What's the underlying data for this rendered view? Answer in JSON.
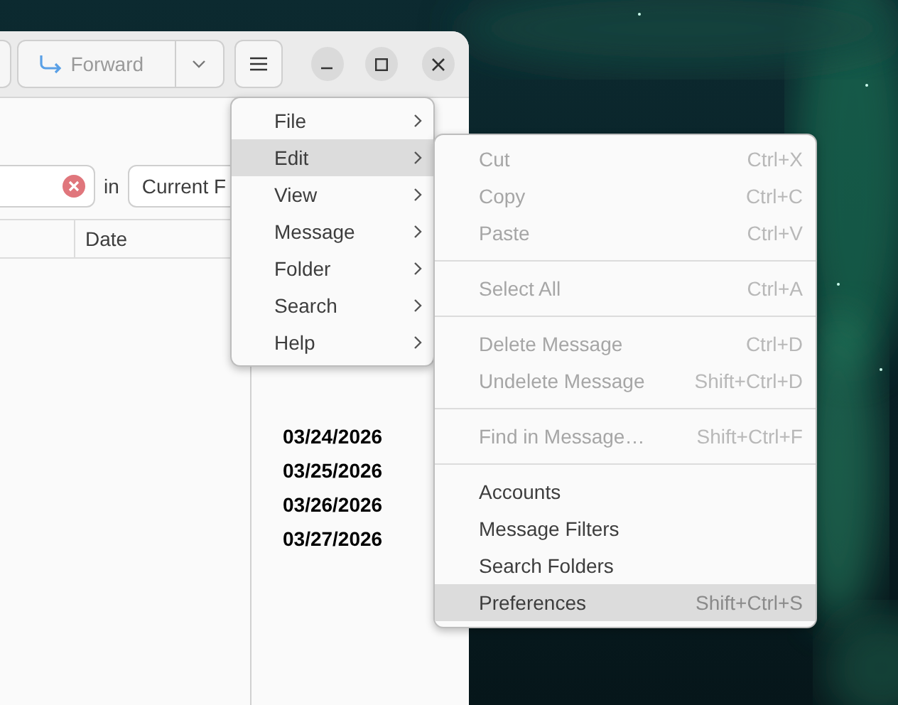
{
  "header": {
    "forward_button": {
      "label": "Forward",
      "disabled": true
    }
  },
  "search": {
    "scope_label": "in",
    "scope": "Current F"
  },
  "message_list": {
    "columns": [
      "Date"
    ],
    "rows": [
      {
        "date": "03/24/2026",
        "unread": true
      },
      {
        "date": "03/25/2026",
        "unread": true
      },
      {
        "date": "03/26/2026",
        "unread": true
      },
      {
        "date": "03/27/2026",
        "unread": true
      }
    ]
  },
  "menu": {
    "items": [
      {
        "label": "File",
        "selected": false
      },
      {
        "label": "Edit",
        "selected": true
      },
      {
        "label": "View",
        "selected": false
      },
      {
        "label": "Message",
        "selected": false
      },
      {
        "label": "Folder",
        "selected": false
      },
      {
        "label": "Search",
        "selected": false
      },
      {
        "label": "Help",
        "selected": false
      }
    ]
  },
  "submenu": {
    "groups": [
      [
        {
          "label": "Cut",
          "shortcut": "Ctrl+X",
          "disabled": true,
          "selected": false
        },
        {
          "label": "Copy",
          "shortcut": "Ctrl+C",
          "disabled": true,
          "selected": false
        },
        {
          "label": "Paste",
          "shortcut": "Ctrl+V",
          "disabled": true,
          "selected": false
        }
      ],
      [
        {
          "label": "Select All",
          "shortcut": "Ctrl+A",
          "disabled": true,
          "selected": false
        }
      ],
      [
        {
          "label": "Delete Message",
          "shortcut": "Ctrl+D",
          "disabled": true,
          "selected": false
        },
        {
          "label": "Undelete Message",
          "shortcut": "Shift+Ctrl+D",
          "disabled": true,
          "selected": false
        }
      ],
      [
        {
          "label": "Find in Message…",
          "shortcut": "Shift+Ctrl+F",
          "disabled": true,
          "selected": false
        }
      ],
      [
        {
          "label": "Accounts",
          "disabled": false,
          "selected": false
        },
        {
          "label": "Message Filters",
          "disabled": false,
          "selected": false
        },
        {
          "label": "Search Folders",
          "disabled": false,
          "selected": false
        },
        {
          "label": "Preferences",
          "shortcut": "Shift+Ctrl+S",
          "disabled": false,
          "selected": true
        }
      ]
    ]
  }
}
